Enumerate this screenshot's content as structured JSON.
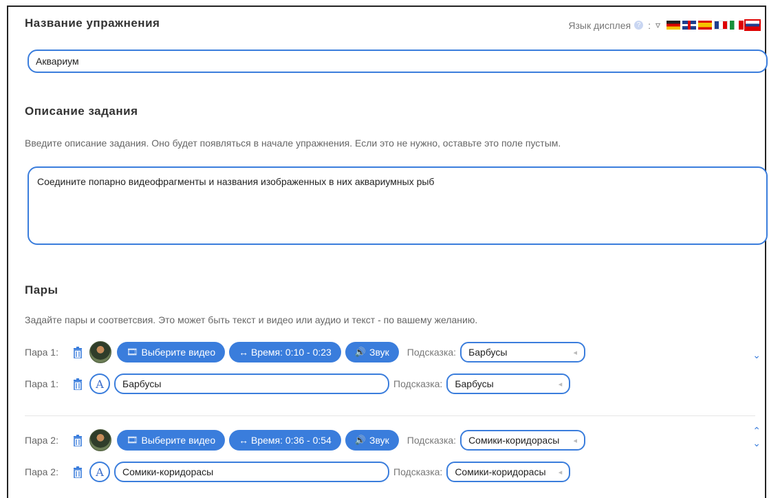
{
  "exercise": {
    "title_label": "Название упражнения",
    "title_value": "Аквариум"
  },
  "display_language": {
    "label": "Язык дисплея",
    "help_icon": "?",
    "separator": ":",
    "dropdown_icon": "▿",
    "flags": [
      "de",
      "gb",
      "es",
      "fr",
      "it",
      "ru"
    ]
  },
  "description": {
    "heading": "Описание задания",
    "hint": "Введите описание задания. Оно будет появляться в начале упражнения. Если это не нужно, оставьте это поле пустым.",
    "value": "Соедините попарно видеофрагменты и названия изображенных в них аквариумных рыб"
  },
  "pairs": {
    "heading": "Пары",
    "hint": "Задайте пары и соответсвия. Это может быть текст и видео или аудио и текст - по вашему желанию.",
    "select_video_label": "Выберите видео",
    "sound_label": "Звук",
    "hint_label": "Подсказка:",
    "items": [
      {
        "label": "Пара 1:",
        "time_label": "↔ Время: 0:10 - 0:23",
        "video_hint": "Барбусы",
        "text_label": "Пара 1:",
        "text_value": "Барбусы",
        "text_hint": "Барбусы"
      },
      {
        "label": "Пара 2:",
        "time_label": "↔ Время: 0:36 - 0:54",
        "video_hint": "Сомики-коридорасы",
        "text_label": "Пара 2:",
        "text_value": "Сомики-коридорасы",
        "text_hint": "Сомики-коридорасы"
      }
    ]
  },
  "icons": {
    "chevron_down": "⌄",
    "chevron_up": "⌃",
    "film": "🎞",
    "speaker": "🔊",
    "letter_a": "A"
  }
}
